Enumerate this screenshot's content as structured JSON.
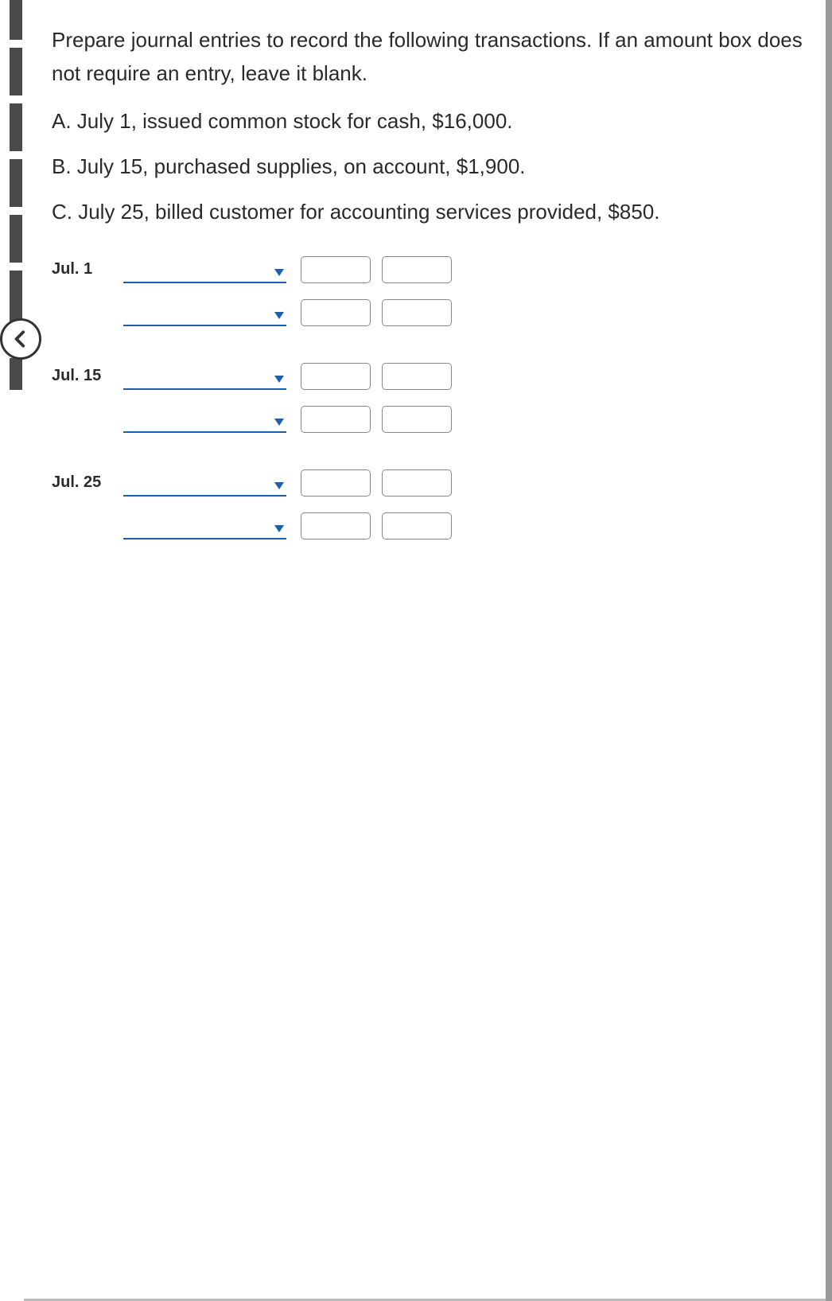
{
  "instruction": "Prepare journal entries to record the following transactions. If an amount box does not require an entry, leave it blank.",
  "transactions": {
    "a": "A. July 1, issued common stock for cash, $16,000.",
    "b": "B. July 15, purchased supplies, on account, $1,900.",
    "c": "C. July 25, billed customer for accounting services provided, $850."
  },
  "journal": {
    "groups": [
      {
        "date": "Jul. 1",
        "rows": [
          {
            "account": "",
            "debit": "",
            "credit": ""
          },
          {
            "account": "",
            "debit": "",
            "credit": ""
          }
        ]
      },
      {
        "date": "Jul. 15",
        "rows": [
          {
            "account": "",
            "debit": "",
            "credit": ""
          },
          {
            "account": "",
            "debit": "",
            "credit": ""
          }
        ]
      },
      {
        "date": "Jul. 25",
        "rows": [
          {
            "account": "",
            "debit": "",
            "credit": ""
          },
          {
            "account": "",
            "debit": "",
            "credit": ""
          }
        ]
      }
    ]
  }
}
